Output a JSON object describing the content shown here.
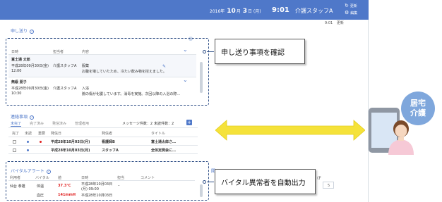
{
  "header": {
    "year": "2016",
    "year_unit": "年",
    "month": "10",
    "month_unit": "月",
    "day": "3",
    "day_unit": "日",
    "weekday": "(月)",
    "time": "9:01",
    "user": "介護スタッフA",
    "refresh_label": "更新",
    "edit_label": "編集"
  },
  "subbar": {
    "time": "9:01",
    "refresh_label": "更新"
  },
  "handover": {
    "title": "申し送り",
    "columns": [
      "日時",
      "担当者",
      "内容"
    ],
    "rows": [
      {
        "name": "富士通 太郎",
        "date": "平成28年09月30日(金)",
        "time": "12:00",
        "staff": "介護スタッフA",
        "topic": "服薬",
        "content": "お腹を壊していたため、冷たい飲み物を控えました。"
      },
      {
        "name": "無級 朋子",
        "date": "平成28年09月30日(金)",
        "time": "10:30",
        "staff": "介護スタッフA",
        "topic": "入浴",
        "content": "腕の傷が化膿しています。消毒を実施。次回以降の入浴の際…"
      }
    ]
  },
  "contact": {
    "title": "連絡事項",
    "tabs": [
      "未完了",
      "完了済み",
      "発信済み",
      "管理者用"
    ],
    "message_count_label": "メッセージ件数：2",
    "unread_count_label": "未読件数：2",
    "columns": [
      "完了",
      "未読",
      "重要",
      "発信日",
      "発信者",
      "タイトル"
    ],
    "rows": [
      {
        "date": "平成28年10月03日(月)",
        "sender": "看護師B",
        "title": "富士通太郎さ…"
      },
      {
        "date": "平成28年10月03日(月)",
        "sender": "スタッフA",
        "title": "全体定例会に…"
      }
    ]
  },
  "vital": {
    "title": "バイタルアラート",
    "columns": [
      "利用者",
      "バイタル",
      "値",
      "日時",
      "担当",
      "コメント"
    ],
    "rows": [
      {
        "name": "仙台 孝雄",
        "vital": "体温",
        "value": "37.3℃",
        "date": "平成28年10月03日",
        "date2": "(月) 09:00",
        "staff": "–"
      },
      {
        "name": "",
        "vital": "血圧",
        "value": "141mmH",
        "date": "平成28年10月03日",
        "date2": "",
        "staff": ""
      }
    ]
  },
  "right_partial": {
    "label": "開",
    "paren": "(F",
    "number": "5"
  },
  "callouts": {
    "handover": "申し送り事項を確認",
    "vital": "バイタル異常者を自動出力"
  },
  "badge": {
    "line1": "居宅",
    "line2": "介護"
  },
  "icons": {
    "refresh": "refresh-icon",
    "edit": "gear-icon",
    "chevron": "chevron-down-icon",
    "pencil": "pencil-icon",
    "help": "help-icon",
    "plus": "plus-icon"
  },
  "colors": {
    "brand": "#4f78c9",
    "alert_value": "#e02020",
    "unread_dot": "#4f78c9",
    "important_dot": "#e02020",
    "badge": "#7fa7dc",
    "arrow": "#f5e23a"
  }
}
